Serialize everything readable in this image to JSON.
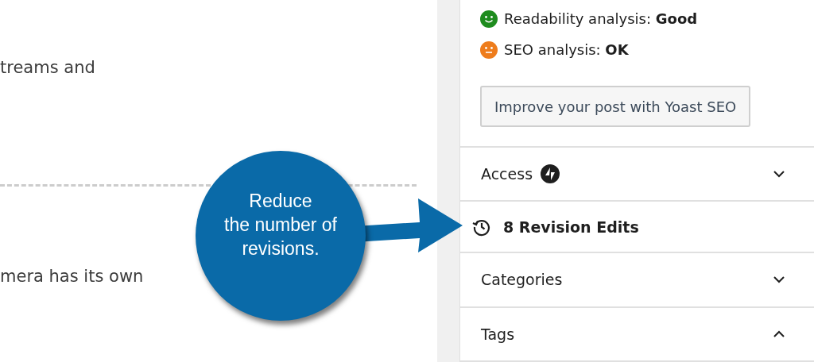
{
  "editor": {
    "paragraphs": [
      "treams and",
      "mera has its own"
    ]
  },
  "sidebar": {
    "analyses": [
      {
        "label": "Readability analysis: ",
        "result": "Good",
        "color": "#1e8c1e",
        "kind": "happy"
      },
      {
        "label": "SEO analysis: ",
        "result": "OK",
        "color": "#ee7c1b",
        "kind": "neutral"
      }
    ],
    "improve_button": "Improve your post with Yoast SEO",
    "panels": [
      {
        "kind": "toggle",
        "title": "Access",
        "badge": true,
        "expanded": false
      },
      {
        "kind": "link",
        "title": "8 Revision Edits"
      },
      {
        "kind": "toggle",
        "title": "Categories",
        "badge": false,
        "expanded": false
      },
      {
        "kind": "toggle",
        "title": "Tags",
        "badge": false,
        "expanded": true
      }
    ]
  },
  "callout": {
    "text": "Reduce\nthe number of\nrevisions."
  }
}
